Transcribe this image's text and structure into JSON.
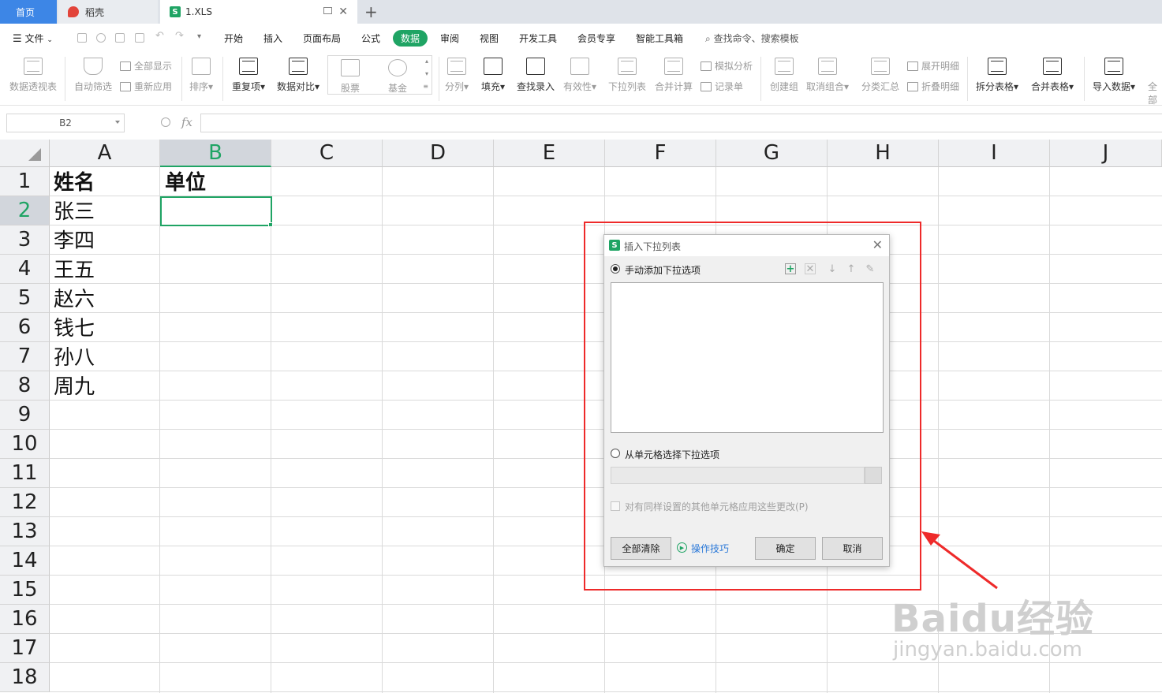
{
  "tabs": {
    "home": "首页",
    "daoke": "稻壳",
    "file": "1.XLS"
  },
  "menu": {
    "file": "文件",
    "items": [
      "开始",
      "插入",
      "页面布局",
      "公式",
      "数据",
      "审阅",
      "视图",
      "开发工具",
      "会员专享",
      "智能工具箱"
    ],
    "search": "查找命令、搜索模板"
  },
  "ribbon": {
    "pivot": "数据透视表",
    "autofilter": "自动筛选",
    "show_all": "全部显示",
    "reapply": "重新应用",
    "sort": "排序",
    "duplicates": "重复项",
    "compare": "数据对比",
    "stock": "股票",
    "fund": "基金",
    "split_col": "分列",
    "fill": "填充",
    "lookup_entry": "查找录入",
    "validity": "有效性",
    "dropdown": "下拉列表",
    "consolidate": "合并计算",
    "what_if": "模拟分析",
    "record_form": "记录单",
    "group": "创建组",
    "ungroup": "取消组合",
    "subtotal": "分类汇总",
    "expand": "展开明细",
    "collapse": "折叠明细",
    "split_table": "拆分表格",
    "merge_table": "合并表格",
    "import_data": "导入数据",
    "more": "全部"
  },
  "formula_bar": {
    "name_box": "B2",
    "fx": "fx",
    "formula": ""
  },
  "sheet": {
    "columns": [
      "A",
      "B",
      "C",
      "D",
      "E",
      "F",
      "G",
      "H",
      "I",
      "J"
    ],
    "selected_column": "B",
    "rows": [
      "1",
      "2",
      "3",
      "4",
      "5",
      "6",
      "7",
      "8",
      "9",
      "10",
      "11",
      "12",
      "13",
      "14",
      "15",
      "16",
      "17",
      "18"
    ],
    "selected_row": "2",
    "a1": "姓名",
    "b1": "单位",
    "names": [
      "张三",
      "李四",
      "王五",
      "赵六",
      "钱七",
      "孙八",
      "周九"
    ],
    "accent_color": "#1fa464"
  },
  "dialog": {
    "title": "插入下拉列表",
    "manual_option": "手动添加下拉选项",
    "from_cells_option": "从单元格选择下拉选项",
    "apply_all": "对有同样设置的其他单元格应用这些更改(P)",
    "clear_all": "全部清除",
    "tips": "操作技巧",
    "ok": "确定",
    "cancel": "取消",
    "toolbar_icons": [
      "add-item-icon",
      "delete-item-icon",
      "move-down-icon",
      "move-up-icon",
      "edit-icon"
    ]
  },
  "annotation": {
    "color": "#ee2a2a"
  },
  "watermark": {
    "main": "Baidu经验",
    "sub": "jingyan.baidu.com"
  }
}
